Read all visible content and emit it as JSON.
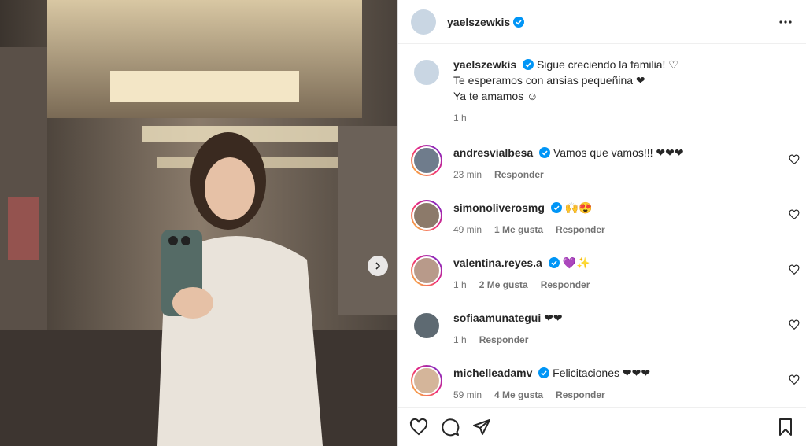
{
  "post": {
    "author": "yaelszewkis",
    "caption_line1": "Sigue creciendo la familia! ♡",
    "caption_line2": "Te esperamos con ansias pequeñina ❤",
    "caption_line3": "Ya te amamos ☺",
    "time": "1 h"
  },
  "comments": [
    {
      "user": "andresvialbesa",
      "text": "Vamos que vamos!!! ❤❤❤",
      "time": "23 min",
      "likes": "",
      "reply": "Responder"
    },
    {
      "user": "simonoliverosmg",
      "text": "🙌😍",
      "time": "49 min",
      "likes": "1 Me gusta",
      "reply": "Responder"
    },
    {
      "user": "valentina.reyes.a",
      "text": "💜✨",
      "time": "1 h",
      "likes": "2 Me gusta",
      "reply": "Responder"
    },
    {
      "user": "sofiaamunategui",
      "text": "❤❤",
      "time": "1 h",
      "likes": "",
      "reply": "Responder"
    },
    {
      "user": "michelleadamv",
      "text": "Felicitaciones ❤❤❤",
      "time": "59 min",
      "likes": "4 Me gusta",
      "reply": "Responder"
    }
  ],
  "icons": {
    "like": "heart-icon",
    "comment": "comment-icon",
    "share": "share-icon",
    "save": "bookmark-icon",
    "more": "more-icon",
    "next": "chevron-right-icon"
  },
  "colors": {
    "verified": "#0095f6",
    "heart": "#ed4956",
    "text": "#262626",
    "muted": "#737373"
  }
}
